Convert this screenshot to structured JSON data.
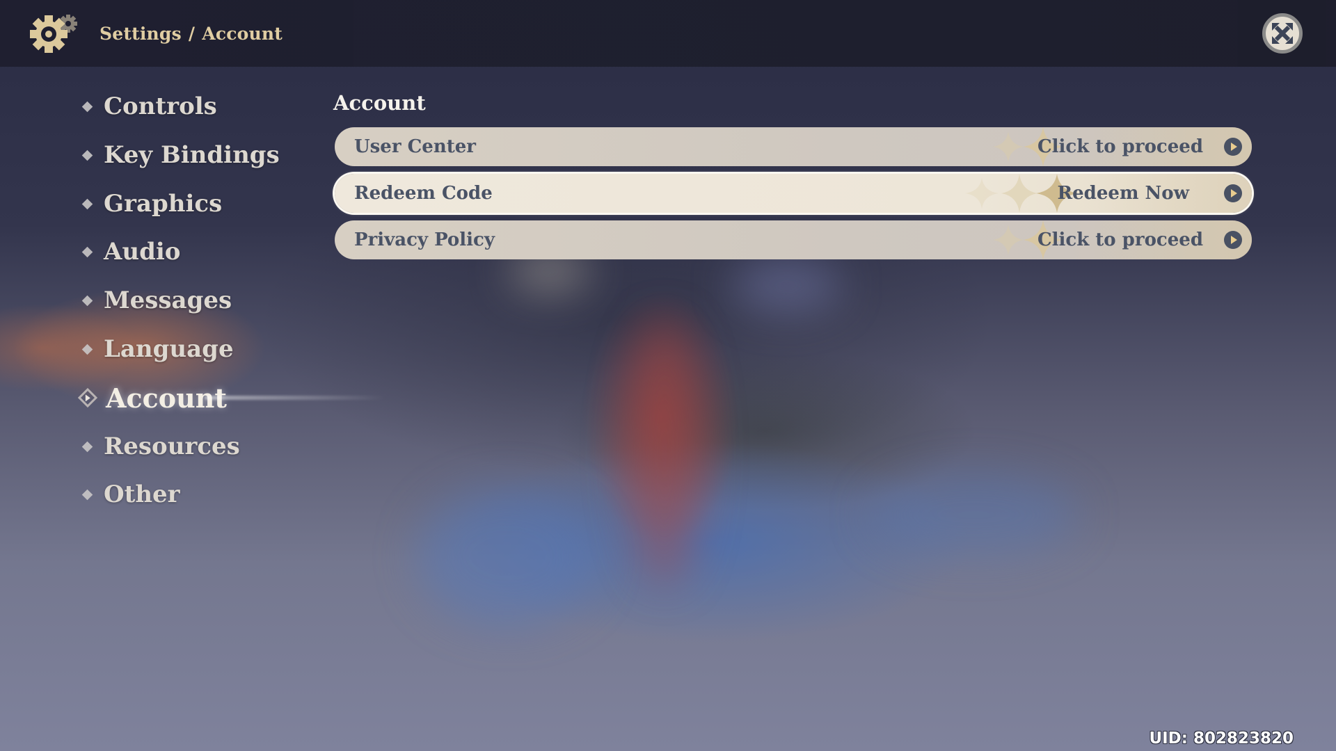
{
  "header": {
    "breadcrumb": [
      "Settings",
      "/",
      "Account"
    ],
    "settings_icon": "gear-icon",
    "close_icon": "close-icon",
    "accent_color": "#e6d3a6"
  },
  "sidebar": {
    "items": [
      {
        "label": "Controls",
        "active": false
      },
      {
        "label": "Key Bindings",
        "active": false
      },
      {
        "label": "Graphics",
        "active": false
      },
      {
        "label": "Audio",
        "active": false
      },
      {
        "label": "Messages",
        "active": false
      },
      {
        "label": "Language",
        "active": false
      },
      {
        "label": "Account",
        "active": true
      },
      {
        "label": "Resources",
        "active": false
      },
      {
        "label": "Other",
        "active": false
      }
    ]
  },
  "main": {
    "section_title": "Account",
    "rows": [
      {
        "label": "User Center",
        "action": "Click to proceed",
        "selected": false
      },
      {
        "label": "Redeem Code",
        "action": "Redeem Now",
        "selected": true
      },
      {
        "label": "Privacy Policy",
        "action": "Click to proceed",
        "selected": false
      }
    ]
  },
  "footer": {
    "uid": "UID: 802823820"
  }
}
